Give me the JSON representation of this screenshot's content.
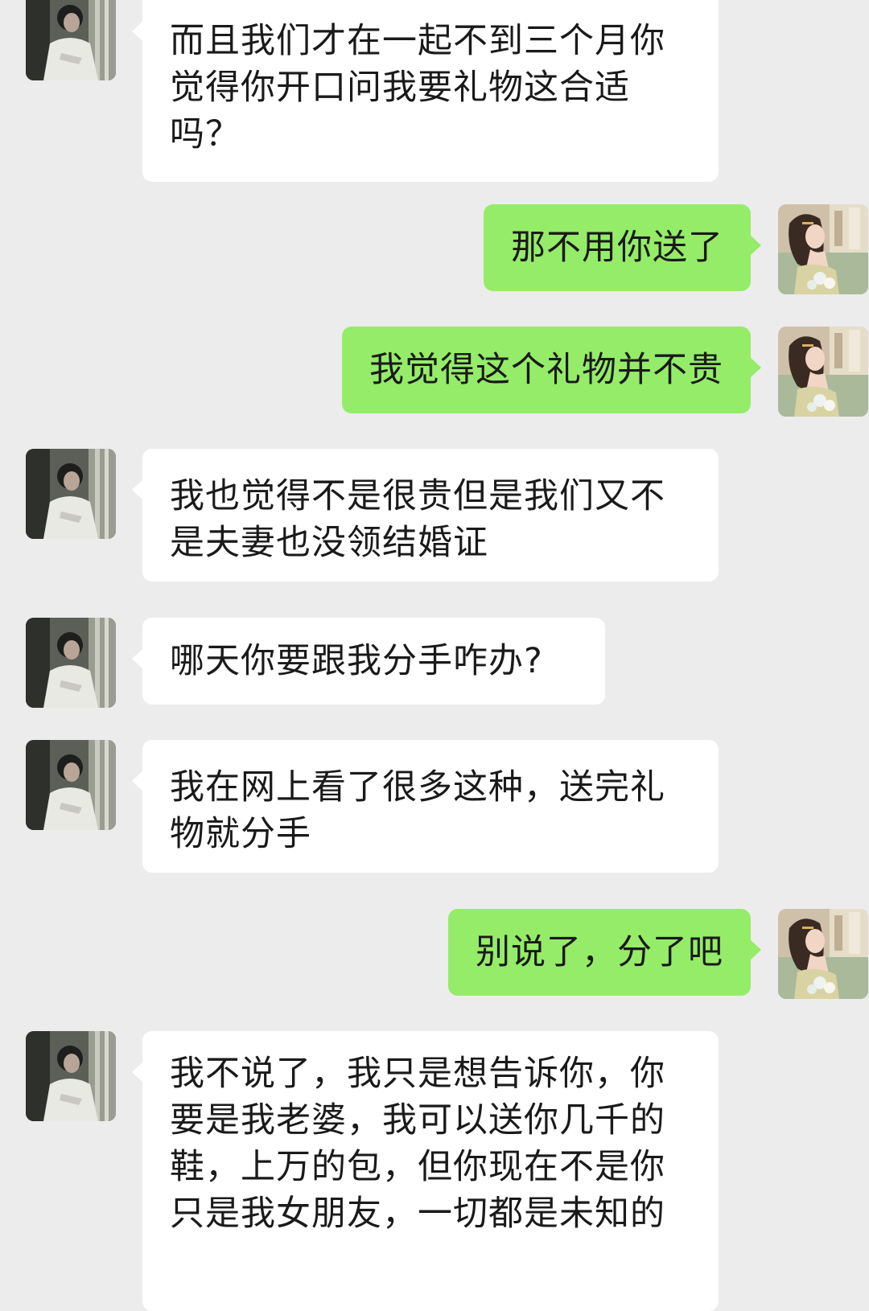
{
  "chat": {
    "messages": [
      {
        "side": "left",
        "text": "而且我们才在一起不到三个月你觉得你开口问我要礼物这合适吗？"
      },
      {
        "side": "right",
        "text": "那不用你送了"
      },
      {
        "side": "right",
        "text": "我觉得这个礼物并不贵"
      },
      {
        "side": "left",
        "text": "我也觉得不是很贵但是我们又不是夫妻也没领结婚证"
      },
      {
        "side": "left",
        "text": "哪天你要跟我分手咋办?"
      },
      {
        "side": "left",
        "text": "我在网上看了很多这种，送完礼物就分手"
      },
      {
        "side": "right",
        "text": "别说了，分了吧"
      },
      {
        "side": "left",
        "text": "我不说了，我只是想告诉你，你要是我老婆，我可以送你几千的鞋，上万的包，但你现在不是你只是我女朋友，一切都是未知的"
      }
    ]
  },
  "colors": {
    "background": "#ececec",
    "incoming_bubble": "#ffffff",
    "outgoing_bubble": "#95ec69",
    "text": "#1a1a1a"
  },
  "icons": {
    "incoming_avatar": "avatar-boy-icon",
    "outgoing_avatar": "avatar-girl-icon"
  }
}
